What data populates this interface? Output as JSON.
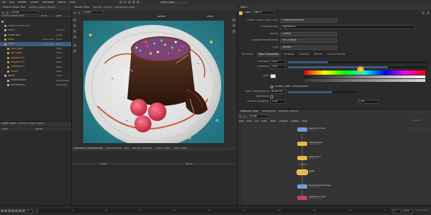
{
  "menu": {
    "items": [
      "File",
      "Edit",
      "Render",
      "Assets",
      "Windows",
      "Solaris",
      "Help"
    ],
    "file_tab": "main1.usd"
  },
  "left_panel": {
    "tabs": [
      "Scene Graph Tree",
      "Scene Graph Details"
    ],
    "path": "/stage",
    "columns": [
      "Scene Graph Path",
      "Kind",
      "Type"
    ],
    "rows": [
      {
        "name": "/",
        "kind": "",
        "type": "",
        "color": "#9a9a9a"
      },
      {
        "name": "HoudiniLayerInfo",
        "kind": "",
        "type": "",
        "color": "#9a9a9a"
      },
      {
        "name": "cam1",
        "kind": "",
        "type": "Camera",
        "color": "#b7b7b7"
      },
      {
        "name": "materials",
        "kind": "",
        "type": "Scope",
        "color": "#b7b7b7"
      },
      {
        "name": "plate",
        "kind": "component",
        "type": "Xform",
        "color": "#c9a24a"
      },
      {
        "name": "cake",
        "kind": "component",
        "type": "Xform",
        "color": "#c9a24a"
      },
      {
        "name": "cake_geo",
        "kind": "",
        "type": "Mesh",
        "color": "#c9a24a"
      },
      {
        "name": "sprinkles",
        "kind": "",
        "type": "Points",
        "color": "#c9a24a"
      },
      {
        "name": "raspberry1",
        "kind": "",
        "type": "Mesh",
        "color": "#c9a24a"
      },
      {
        "name": "raspberry2",
        "kind": "",
        "type": "Mesh",
        "color": "#c9a24a"
      },
      {
        "name": "raspberry3",
        "kind": "",
        "type": "Mesh",
        "color": "#c9a24a"
      },
      {
        "name": "sauce",
        "kind": "",
        "type": "Mesh",
        "color": "#c9a24a"
      },
      {
        "name": "lights",
        "kind": "",
        "type": "Scope",
        "color": "#b7b7b7"
      },
      {
        "name": "distantlight1",
        "kind": "",
        "type": "DistantLight",
        "color": "#b7b7b7"
      },
      {
        "name": "domelight1",
        "kind": "",
        "type": "DomeLight",
        "color": "#b7b7b7"
      }
    ],
    "bottom_tabs": [
      "Layer Stack",
      "Scene Graph Layers"
    ],
    "bottom_columns": [
      "Layer",
      "Value"
    ]
  },
  "viewport": {
    "tabs": [
      "Scene View",
      "Render Gallery",
      "Composite View"
    ],
    "path": "/stage",
    "camera": "cam1",
    "renderer": "Karma"
  },
  "bottom_center": {
    "tabs": [
      "Geometry Spreadsheet",
      "Environment Light",
      "Render Settings",
      "Light Linker",
      "Light Mixer"
    ],
    "columns": [
      "Label",
      "Value"
    ]
  },
  "params": {
    "tab": "light1",
    "node_type": "Light",
    "node_name": "light1",
    "rows": [
      {
        "label": "Create Prims / Edit Prims",
        "value": "Create primitives"
      },
      {
        "label": "Primitive Path",
        "value": "/lights/$OS"
      },
      {
        "label": "Action",
        "value": "Create"
      },
      {
        "label": "Initialize Parameters",
        "value": "No Change"
      },
      {
        "label": "Type",
        "value": "Sphere"
      }
    ],
    "subtabs": [
      "Transform",
      "Base Properties",
      "Shaping",
      "Shadow",
      "Karma",
      "Karma Render"
    ],
    "intensity_label": "Intensity",
    "intensity": "3.42",
    "exposure_label": "Exposure",
    "exposure": "1.45",
    "color_label": "Color",
    "enable_temp_label": "Enable Color Temperature",
    "temp_label": "Color Temperature",
    "temp": "6500.00",
    "normalize_label": "Normalize",
    "diffuse_label": "Diffuse Multiplier",
    "diffuse": "1.00",
    "spec_label": "Specular Multiplier",
    "spec": "1.00",
    "treat_as_point": "Treat as Point"
  },
  "network": {
    "tabs": [
      "Network View",
      "Parameters",
      "Material Palette"
    ],
    "path": "/stage",
    "menu": [
      "Add",
      "Edit",
      "Go",
      "View",
      "Tools",
      "Layout",
      "Labels",
      "Help"
    ],
    "context_label": "Solaris",
    "watermark": "Solaris",
    "nodes": [
      {
        "name": "plate_and_cake",
        "type": "sublayer",
        "color": "#6fa0d8"
      },
      {
        "name": "distantlight1",
        "type": "distantlight",
        "color": "#e8b84a"
      },
      {
        "name": "lightmixer1",
        "type": "lightmixer",
        "color": "#e8b84a"
      },
      {
        "name": "light1",
        "type": "light",
        "color": "#e8b84a"
      },
      {
        "name": "karmarendersettings",
        "type": "karmarender",
        "color": "#6fa0d8"
      },
      {
        "name": "usdrender_rop1",
        "type": "usdrender_rop",
        "color": "#c24070"
      }
    ]
  },
  "timeline": {
    "frame": "1",
    "start": "1",
    "end": "240",
    "ticks": [
      "1",
      "24",
      "48",
      "72",
      "96",
      "120",
      "144",
      "168",
      "192",
      "216",
      "240"
    ]
  },
  "statusbar": {
    "message": "Ctrl-click on parameters to add, drag to reorder",
    "auto_update": "Auto Update"
  },
  "colors": {
    "accent_yellow": "#e8b84a",
    "accent_blue": "#6fa0d8",
    "selection": "#3d5a80",
    "timeline_marker": "#c23030"
  }
}
